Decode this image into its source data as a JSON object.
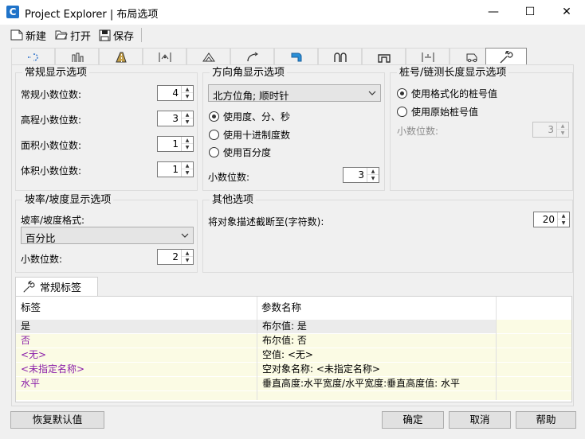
{
  "window": {
    "app_icon": "C",
    "title": "Project Explorer | 布局选项",
    "minimize_glyph": "—",
    "maximize_glyph": "☐",
    "close_glyph": "✕"
  },
  "toolbar": {
    "new_label": "新建",
    "open_label": "打开",
    "save_label": "保存"
  },
  "tabs": [
    {
      "icon": "alignment-icon"
    },
    {
      "icon": "profile-view-icon"
    },
    {
      "icon": "corridor-icon"
    },
    {
      "icon": "section-icon"
    },
    {
      "icon": "surface-icon"
    },
    {
      "icon": "curve-icon"
    },
    {
      "icon": "assembly-icon"
    },
    {
      "icon": "pipe-network-icon"
    },
    {
      "icon": "pressure-pipe-icon"
    },
    {
      "icon": "dimension-icon"
    },
    {
      "icon": "vehicle-icon"
    },
    {
      "icon": "wrench-icon"
    }
  ],
  "general_display": {
    "title": "常规显示选项",
    "rows": [
      {
        "label": "常规小数位数:",
        "value": "4"
      },
      {
        "label": "高程小数位数:",
        "value": "3"
      },
      {
        "label": "面积小数位数:",
        "value": "1"
      },
      {
        "label": "体积小数位数:",
        "value": "1"
      }
    ]
  },
  "direction_display": {
    "title": "方向角显示选项",
    "combo_value": "北方位角; 顺时针",
    "radios": [
      {
        "label": "使用度、分、秒",
        "checked": true
      },
      {
        "label": "使用十进制度数",
        "checked": false
      },
      {
        "label": "使用百分度",
        "checked": false
      }
    ],
    "decimals_label": "小数位数:",
    "decimals_value": "3"
  },
  "station_display": {
    "title": "桩号/链测长度显示选项",
    "radios": [
      {
        "label": "使用格式化的桩号值",
        "checked": true
      },
      {
        "label": "使用原始桩号值",
        "checked": false
      }
    ],
    "decimals_label": "小数位数:",
    "decimals_value": "3"
  },
  "grade_display": {
    "title": "坡率/坡度显示选项",
    "format_label": "坡率/坡度格式:",
    "format_value": "百分比",
    "decimals_label": "小数位数:",
    "decimals_value": "2"
  },
  "other_options": {
    "title": "其他选项",
    "truncate_label": "将对象描述截断至(字符数):",
    "truncate_value": "20"
  },
  "labels_tab": {
    "label": "常规标签",
    "columns": [
      "标签",
      "参数名称",
      ""
    ],
    "rows": [
      {
        "label": "是",
        "param": "布尔值: 是",
        "style": "black"
      },
      {
        "label": "否",
        "param": "布尔值: 否",
        "style": "purple"
      },
      {
        "label": "<无>",
        "param": "空值: <无>",
        "style": "purple"
      },
      {
        "label": "<未指定名称>",
        "param": "空对象名称: <未指定名称>",
        "style": "purple"
      },
      {
        "label": "水平",
        "param": "垂直高度:水平宽度/水平宽度:垂直高度值: 水平",
        "style": "purple"
      },
      {
        "label": "",
        "param": "",
        "style": "black"
      }
    ]
  },
  "footer": {
    "restore_label": "恢复默认值",
    "ok_label": "确定",
    "cancel_label": "取消",
    "help_label": "帮助"
  }
}
